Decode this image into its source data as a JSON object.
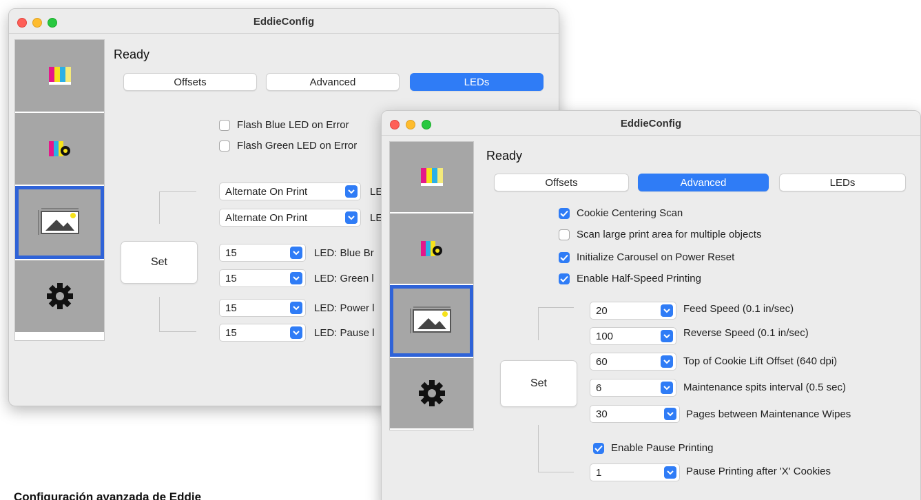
{
  "caption": "Configuración avanzada de Eddie",
  "window_back": {
    "title": "EddieConfig",
    "status": "Ready",
    "tabs": [
      "Offsets",
      "Advanced",
      "LEDs"
    ],
    "checkboxes": [
      {
        "label": "Flash Blue LED on Error",
        "checked": false
      },
      {
        "label": "Flash Green LED on Error",
        "checked": false
      }
    ],
    "selects": [
      {
        "value": "Alternate On Print",
        "label": "LE"
      },
      {
        "value": "Alternate On Print",
        "label": "LE"
      },
      {
        "value": "15",
        "label": "LED: Blue Br"
      },
      {
        "value": "15",
        "label": "LED: Green l"
      },
      {
        "value": "15",
        "label": "LED: Power l"
      },
      {
        "value": "15",
        "label": "LED: Pause l"
      }
    ],
    "set_label": "Set"
  },
  "window_front": {
    "title": "EddieConfig",
    "status": "Ready",
    "tabs": [
      "Offsets",
      "Advanced",
      "LEDs"
    ],
    "checkboxes": [
      {
        "label": "Cookie Centering Scan",
        "checked": true
      },
      {
        "label": "Scan large print area for multiple objects",
        "checked": false
      },
      {
        "label": "Initialize Carousel on Power Reset",
        "checked": true
      },
      {
        "label": "Enable Half-Speed Printing",
        "checked": true
      }
    ],
    "selects": [
      {
        "value": "20",
        "label": "Feed Speed (0.1 in/sec)"
      },
      {
        "value": "100",
        "label": "Reverse Speed (0.1 in/sec)"
      },
      {
        "value": "60",
        "label": "Top of Cookie Lift Offset (640 dpi)"
      },
      {
        "value": "6",
        "label": "Maintenance spits interval (0.5 sec)"
      },
      {
        "value": "30",
        "label": "Pages between Maintenance Wipes"
      }
    ],
    "pause_checkbox": {
      "label": "Enable Pause Printing",
      "checked": true
    },
    "pause_select": {
      "value": "1",
      "label": "Pause Printing after 'X' Cookies"
    },
    "set_label": "Set"
  },
  "colors": {
    "accent": "#2f7cf6",
    "selection": "#2f63d8",
    "tile": "#a6a6a6"
  }
}
